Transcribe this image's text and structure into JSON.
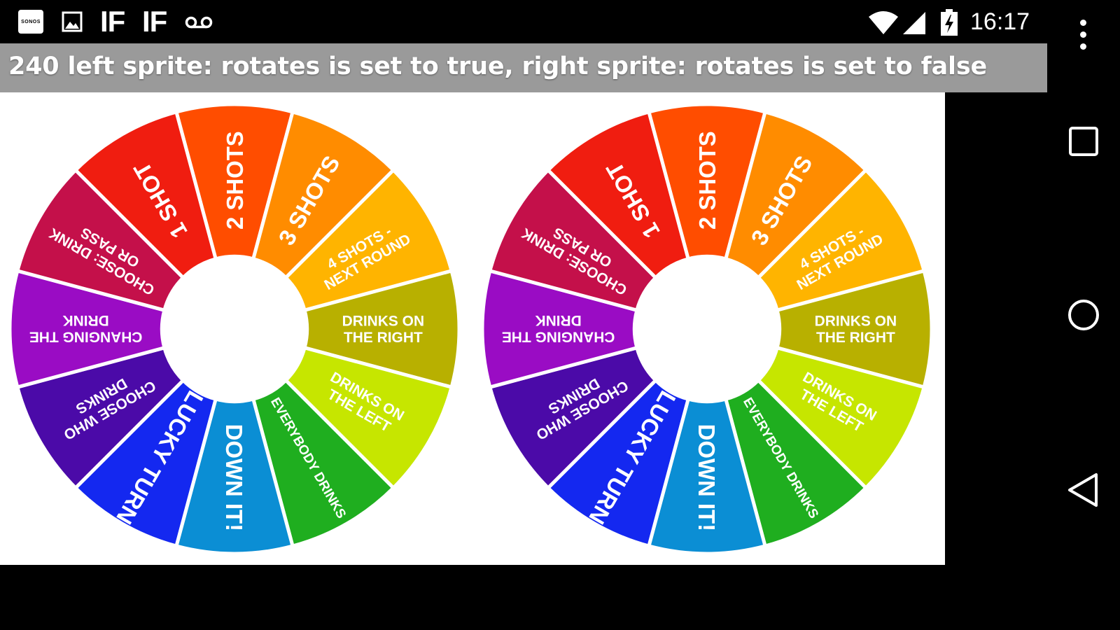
{
  "status_bar": {
    "icons": [
      "sonos-icon",
      "image-icon",
      "if-icon",
      "if-icon",
      "voicemail-icon",
      "wifi-icon",
      "signal-icon",
      "battery-charging-icon"
    ],
    "sonos_label": "SONOS",
    "if_label": "IF",
    "time": "16:17"
  },
  "app": {
    "title": "240 left sprite: rotates is set to true, right sprite: rotates is set to false"
  },
  "wheel": {
    "segments": [
      {
        "lines": [
          "2 SHOTS"
        ],
        "color": "#ff4d00"
      },
      {
        "lines": [
          "3 SHOTS"
        ],
        "color": "#ff8c00"
      },
      {
        "lines": [
          "4 SHOTS -",
          "NEXT ROUND"
        ],
        "color": "#ffb400"
      },
      {
        "lines": [
          "DRINKS ON",
          "THE RIGHT"
        ],
        "color": "#b8b000"
      },
      {
        "lines": [
          "DRINKS ON",
          "THE LEFT"
        ],
        "color": "#c6e600"
      },
      {
        "lines": [
          "EVERYBODY DRINKS"
        ],
        "color": "#1fae1f"
      },
      {
        "lines": [
          "DOWN IT!"
        ],
        "color": "#0b8ed4"
      },
      {
        "lines": [
          "LUCKY TURN"
        ],
        "color": "#1428f0"
      },
      {
        "lines": [
          "CHOOSE WHO",
          "DRINKS"
        ],
        "color": "#4b0aa8"
      },
      {
        "lines": [
          "CHANGING THE",
          "DRINK"
        ],
        "color": "#9a0cc4"
      },
      {
        "lines": [
          "CHOOSE: DRINK",
          "OR PASS"
        ],
        "color": "#c4104a"
      },
      {
        "lines": [
          "1 SHOT"
        ],
        "color": "#f01d10"
      }
    ]
  },
  "navigation": {
    "icons": [
      "overflow-menu-icon",
      "recents-icon",
      "home-icon",
      "back-icon"
    ]
  }
}
